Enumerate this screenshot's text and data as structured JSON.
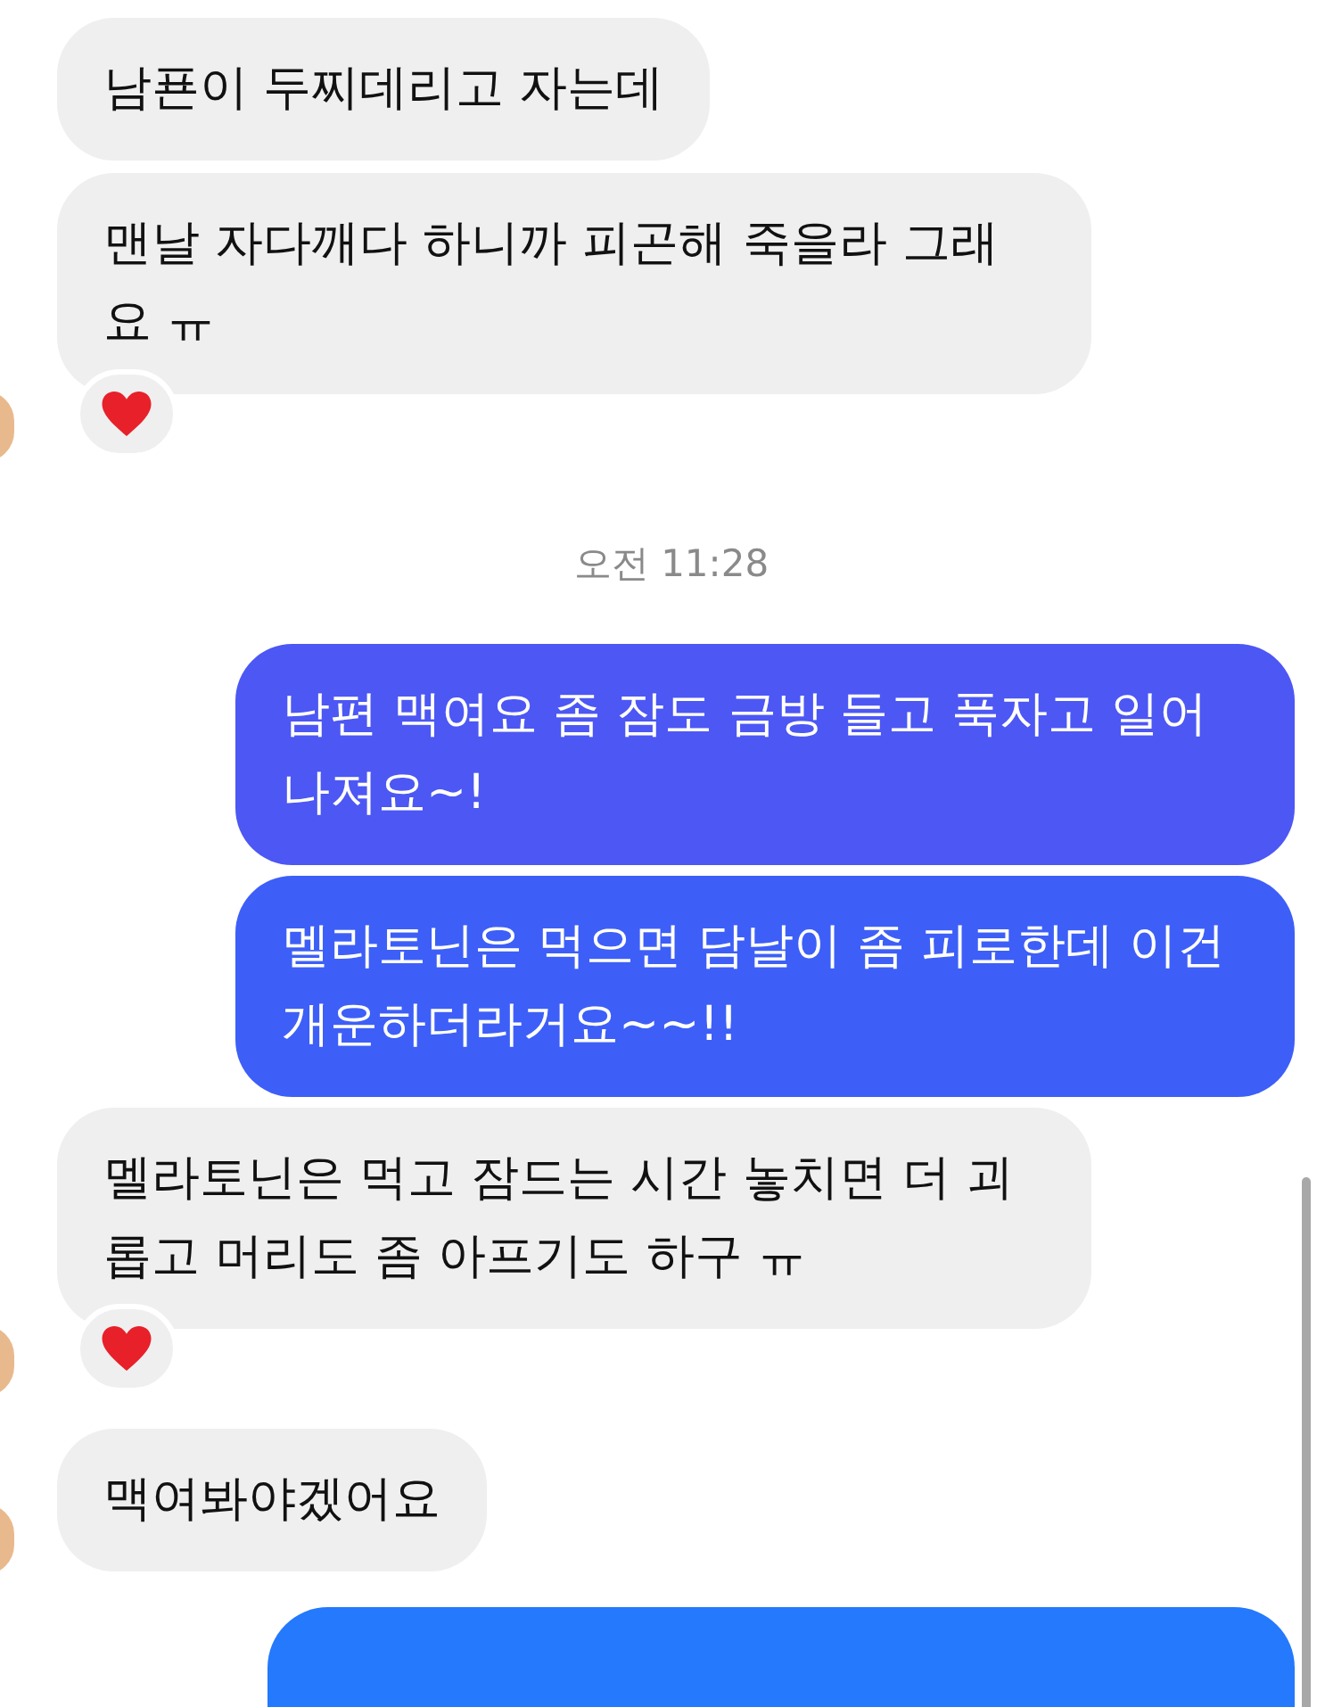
{
  "messages": [
    {
      "kind": "incoming",
      "text": "남푠이 두찌데리고 자는데",
      "avatar": false,
      "reaction": false
    },
    {
      "kind": "incoming",
      "text": "맨날 자다깨다 하니까 피곤해 죽을라 그래요 ㅠ",
      "avatar": true,
      "reaction": true
    },
    {
      "kind": "time",
      "text": "오전 11:28"
    },
    {
      "kind": "outgoing",
      "text": "남편 맥여요 좀 잠도 금방 들고 푹자고 일어나져요~!",
      "color": "#4c57f4"
    },
    {
      "kind": "outgoing",
      "text": "멜라토닌은 먹으면 담날이 좀 피로한데 이건 개운하더라거요~~!!",
      "color": "#3d5ff7"
    },
    {
      "kind": "incoming",
      "text": "멜라토닌은 먹고 잠드는 시간 놓치면 더 괴롭고 머리도 좀 아프기도 하구 ㅠ",
      "avatar": true,
      "reaction": true
    },
    {
      "kind": "incoming",
      "text": "맥여봐야겠어요",
      "avatar": true,
      "reaction": false
    },
    {
      "kind": "outgoing",
      "color": "#2479fd"
    }
  ]
}
